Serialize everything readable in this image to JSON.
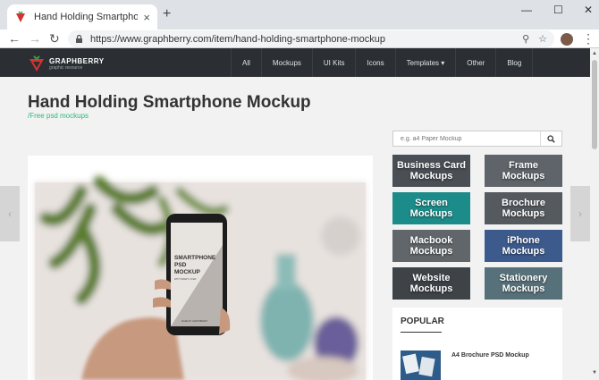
{
  "browser": {
    "tab_title": "Hand Holding Smartphone Mockup",
    "close_glyph": "×",
    "new_tab_glyph": "+",
    "window_controls": {
      "minimize": "—",
      "maximize": "☐",
      "close": "✕"
    },
    "nav": {
      "back": "←",
      "forward": "→",
      "reload": "↻"
    },
    "url": "https://www.graphberry.com/item/hand-holding-smartphone-mockup",
    "zoom_glyph": "⚲",
    "star_glyph": "☆",
    "menu_glyph": "⋮"
  },
  "site": {
    "logo_name": "GRAPHBERRY",
    "logo_sub": "graphic resource",
    "brand_color": "#d6322f",
    "nav": [
      {
        "label": "All"
      },
      {
        "label": "Mockups"
      },
      {
        "label": "UI Kits"
      },
      {
        "label": "Icons"
      },
      {
        "label": "Templates ▾"
      },
      {
        "label": "Other"
      },
      {
        "label": "Blog"
      }
    ]
  },
  "page": {
    "title": "Hand Holding Smartphone Mockup",
    "breadcrumb": "/Free psd mockups",
    "accent_color": "#2fb67c",
    "prev_arrow": "‹",
    "next_arrow": "›"
  },
  "hero": {
    "phone_lines": [
      "SMARTPHONE",
      "PSD",
      "MOCKUP"
    ],
    "phone_small": "WITH SMART LAYER",
    "phone_credit": "MADE BY GRAPHBERRY"
  },
  "search": {
    "placeholder": "e.g. a4 Paper Mockup",
    "icon": "search-icon"
  },
  "categories": [
    {
      "line1": "Business Card",
      "line2": "Mockups",
      "color": "#4a4f55"
    },
    {
      "line1": "Frame",
      "line2": "Mockups",
      "color": "#5e6469"
    },
    {
      "line1": "Screen",
      "line2": "Mockups",
      "color": "#1c8c8a"
    },
    {
      "line1": "Brochure",
      "line2": "Mockups",
      "color": "#555a5f"
    },
    {
      "line1": "Macbook",
      "line2": "Mockups",
      "color": "#61666b"
    },
    {
      "line1": "iPhone",
      "line2": "Mockups",
      "color": "#3d5a8c"
    },
    {
      "line1": "Website",
      "line2": "Mockups",
      "color": "#3e4348"
    },
    {
      "line1": "Stationery",
      "line2": "Mockups",
      "color": "#57717a"
    }
  ],
  "popular": {
    "heading": "POPULAR",
    "items": [
      {
        "title": "A4 Brochure PSD Mockup"
      }
    ]
  },
  "scrollbar": {
    "up": "▲",
    "down": "▼"
  }
}
